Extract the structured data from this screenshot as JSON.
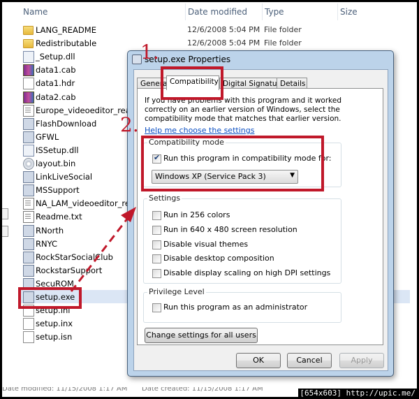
{
  "explorer": {
    "columns": [
      "Name",
      "Date modified",
      "Type",
      "Size"
    ],
    "files": [
      {
        "name": "LANG_README",
        "date": "12/6/2008 5:04 PM",
        "type": "File folder",
        "icon": "folder-icon"
      },
      {
        "name": "Redistributable",
        "date": "12/6/2008 5:04 PM",
        "type": "File folder",
        "icon": "folder-icon"
      },
      {
        "name": "_Setup.dll",
        "date": "",
        "type": "",
        "icon": "dll-icon"
      },
      {
        "name": "data1.cab",
        "date": "",
        "type": "",
        "icon": "cab-icon"
      },
      {
        "name": "data1.hdr",
        "date": "",
        "type": "",
        "icon": "file-icon"
      },
      {
        "name": "data2.cab",
        "date": "",
        "type": "",
        "icon": "cab-icon"
      },
      {
        "name": "Europe_videoeditor_readme",
        "date": "",
        "type": "",
        "icon": "doc-icon"
      },
      {
        "name": "FlashDownload",
        "date": "",
        "type": "",
        "icon": "exe-icon"
      },
      {
        "name": "GFWL",
        "date": "",
        "type": "",
        "icon": "exe-icon"
      },
      {
        "name": "ISSetup.dll",
        "date": "",
        "type": "",
        "icon": "dll-icon"
      },
      {
        "name": "layout.bin",
        "date": "",
        "type": "",
        "icon": "disc-icon"
      },
      {
        "name": "LinkLiveSocial",
        "date": "",
        "type": "",
        "icon": "exe-icon"
      },
      {
        "name": "MSSupport",
        "date": "",
        "type": "",
        "icon": "exe-icon"
      },
      {
        "name": "NA_LAM_videoeditor_readme",
        "date": "",
        "type": "",
        "icon": "doc-icon"
      },
      {
        "name": "Readme.txt",
        "date": "",
        "type": "",
        "icon": "doc-icon"
      },
      {
        "name": "RNorth",
        "date": "",
        "type": "",
        "icon": "exe-icon"
      },
      {
        "name": "RNYC",
        "date": "",
        "type": "",
        "icon": "exe-icon"
      },
      {
        "name": "RockStarSocialClub",
        "date": "",
        "type": "",
        "icon": "exe-icon"
      },
      {
        "name": "RockstarSupport",
        "date": "",
        "type": "",
        "icon": "exe-icon"
      },
      {
        "name": "SecuROM",
        "date": "",
        "type": "",
        "icon": "exe-icon"
      },
      {
        "name": "setup.exe",
        "date": "",
        "type": "",
        "icon": "setup-exe-icon"
      },
      {
        "name": "setup.ini",
        "date": "",
        "type": "",
        "icon": "file-icon"
      },
      {
        "name": "setup.inx",
        "date": "",
        "type": "",
        "icon": "file-icon"
      },
      {
        "name": "setup.isn",
        "date": "",
        "type": "",
        "icon": "file-icon"
      }
    ],
    "status_left": "Date modified: 11/15/2008 1:17 AM",
    "status_right": "Date created: 11/15/2008 1:17 AM"
  },
  "dialog": {
    "title": "setup.exe Properties",
    "tabs": [
      "General",
      "Compatibility",
      "Digital Signatures",
      "Details"
    ],
    "description": "If you have problems with this program and it worked correctly on an earlier version of Windows, select the compatibility mode that matches that earlier version.",
    "help_link": "Help me choose the settings",
    "compat_group": "Compatibility mode",
    "compat_checkbox": "Run this program in compatibility mode for:",
    "compat_selected": "Windows XP (Service Pack 3)",
    "settings_group": "Settings",
    "settings": [
      "Run in 256 colors",
      "Run in 640 x 480 screen resolution",
      "Disable visual themes",
      "Disable desktop composition",
      "Disable display scaling on high DPI settings"
    ],
    "privilege_group": "Privilege Level",
    "privilege_checkbox": "Run this program as an administrator",
    "change_all_button": "Change settings for all users",
    "ok_button": "OK",
    "cancel_button": "Cancel",
    "apply_button": "Apply"
  },
  "annotations": {
    "step1": "1.",
    "step2": "2."
  },
  "watermark": "[654x603] http://upic.me/",
  "colors": {
    "annotation_red": "#c0182a",
    "link_blue": "#0a4ec2"
  }
}
